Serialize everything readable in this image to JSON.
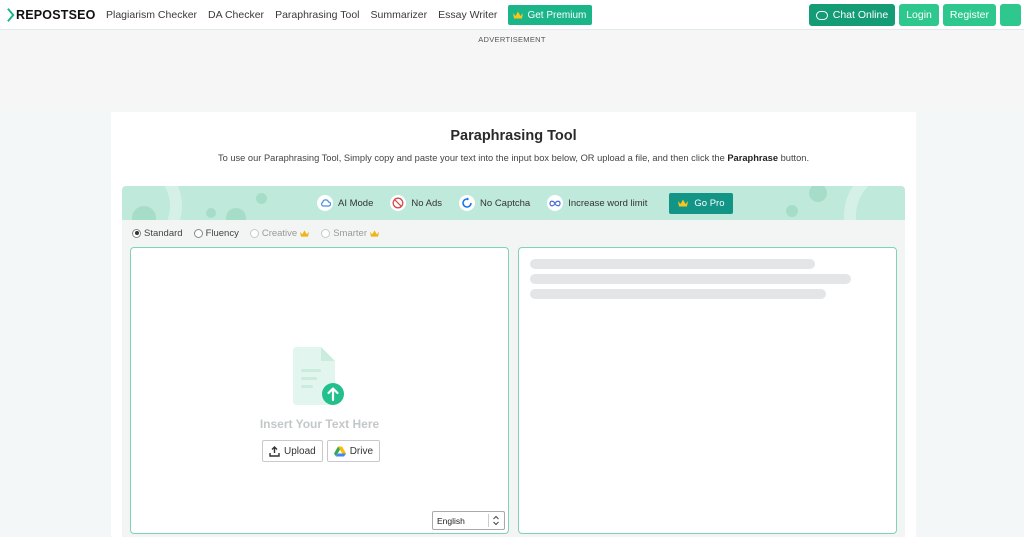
{
  "header": {
    "logo_text": "REPOSTSEO",
    "nav": [
      "Plagiarism Checker",
      "DA Checker",
      "Paraphrasing Tool",
      "Summarizer",
      "Essay Writer"
    ],
    "premium_label": "Get Premium",
    "chat_label": "Chat Online",
    "login_label": "Login",
    "register_label": "Register"
  },
  "ad": {
    "label": "ADVERTISEMENT"
  },
  "tool": {
    "title": "Paraphrasing Tool",
    "subtitle_pre": "To use our Paraphrasing Tool, Simply copy and paste your text into the input box below, OR upload a file, and then click the ",
    "subtitle_bold": "Paraphrase",
    "subtitle_post": " button."
  },
  "promo": {
    "items": [
      "AI Mode",
      "No Ads",
      "No Captcha",
      "Increase word limit"
    ],
    "go_pro": "Go Pro"
  },
  "modes": {
    "items": [
      "Standard",
      "Fluency",
      "Creative",
      "Smarter"
    ],
    "selected": "Standard"
  },
  "input": {
    "placeholder": "Insert Your Text Here",
    "upload_label": "Upload",
    "drive_label": "Drive",
    "language": "English"
  },
  "colors": {
    "accent": "#2ec78d",
    "premium": "#1bb58a",
    "go_pro": "#129487",
    "panel_border": "#7fd3b4"
  }
}
